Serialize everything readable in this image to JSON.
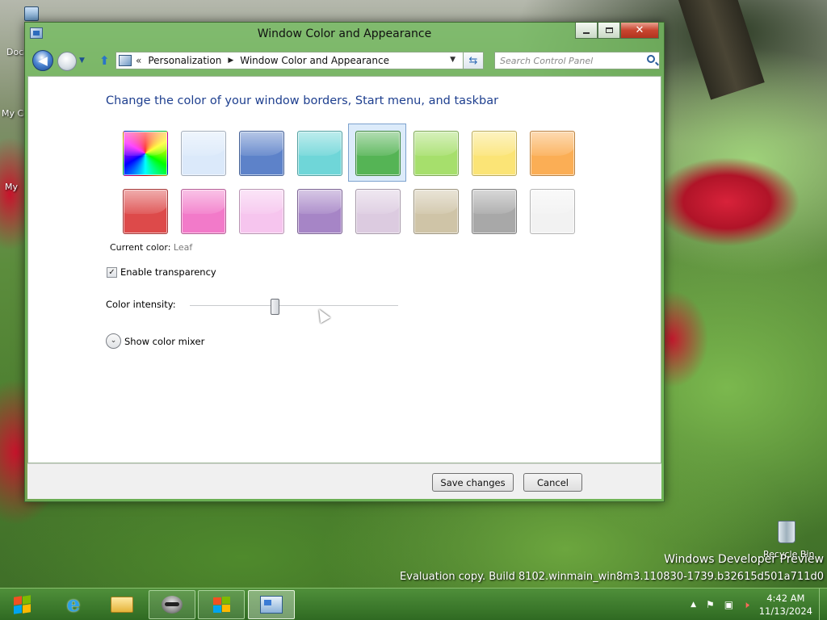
{
  "desktop": {
    "icons": [
      {
        "label": "Doc"
      },
      {
        "label": "My C"
      },
      {
        "label": "My"
      },
      {
        "label": "Recycle Bin"
      }
    ],
    "watermark_line1": "Windows Developer Preview",
    "watermark_line2": "Evaluation copy. Build 8102.winmain_win8m3.110830-1739.b32615d501a711d0"
  },
  "window": {
    "title": "Window Color and Appearance",
    "caption_close": "✕",
    "navigation": {
      "back_glyph": "◀",
      "dropdown_glyph": "▼",
      "up_glyph": "⬆",
      "address_chevron": "«",
      "breadcrumbs": [
        "Personalization",
        "Window Color and Appearance"
      ],
      "breadcrumb_separator": "▶",
      "address_dropdown_glyph": "▼",
      "refresh_glyph": "⇆",
      "search_placeholder": "Search Control Panel"
    },
    "heading": "Change the color of your window borders, Start menu, and taskbar",
    "swatches": [
      {
        "name": "rainbow",
        "color": "rainbow"
      },
      {
        "name": "sky",
        "color": "#dbe9fa"
      },
      {
        "name": "twilight",
        "color": "#5d82c9"
      },
      {
        "name": "sea-foam",
        "color": "#6fd6d8"
      },
      {
        "name": "leaf",
        "color": "#55b455",
        "selected": true
      },
      {
        "name": "lime",
        "color": "#a6df6c"
      },
      {
        "name": "lemon",
        "color": "#fbe476"
      },
      {
        "name": "pumpkin",
        "color": "#fbae55"
      },
      {
        "name": "ruby",
        "color": "#dd4a4a"
      },
      {
        "name": "fuchsia",
        "color": "#f27ac9"
      },
      {
        "name": "blush",
        "color": "#f6c5ee"
      },
      {
        "name": "violet",
        "color": "#a685c6"
      },
      {
        "name": "lavender",
        "color": "#dccbe0"
      },
      {
        "name": "taupe",
        "color": "#cfc4a7"
      },
      {
        "name": "chocolate",
        "color": "#a8a8a8"
      },
      {
        "name": "frost",
        "color": "#f2f2f2"
      }
    ],
    "current_color_label": "Current color:",
    "current_color_value": "Leaf",
    "transparency_label": "Enable transparency",
    "transparency_checked": true,
    "checkbox_glyph": "✓",
    "intensity_label": "Color intensity:",
    "intensity_level": 0.41,
    "mixer_label": "Show color mixer",
    "mixer_glyph": "⌄",
    "save_button": "Save changes",
    "cancel_button": "Cancel"
  },
  "taskbar": {
    "ie_glyph": "e",
    "tray_icons": [
      "up-arrow-icon",
      "flag-icon",
      "network-icon",
      "volume-muted-icon"
    ],
    "tray_glyphs": {
      "up": "▲",
      "flag": "⚑",
      "network": "▣",
      "volume": "🕨"
    },
    "time": "4:42 AM",
    "date": "11/13/2024"
  },
  "colors": {
    "window_frame": "#74be60",
    "heading_blue": "#1e3f8f",
    "taskbar": "#3f7a2c"
  }
}
